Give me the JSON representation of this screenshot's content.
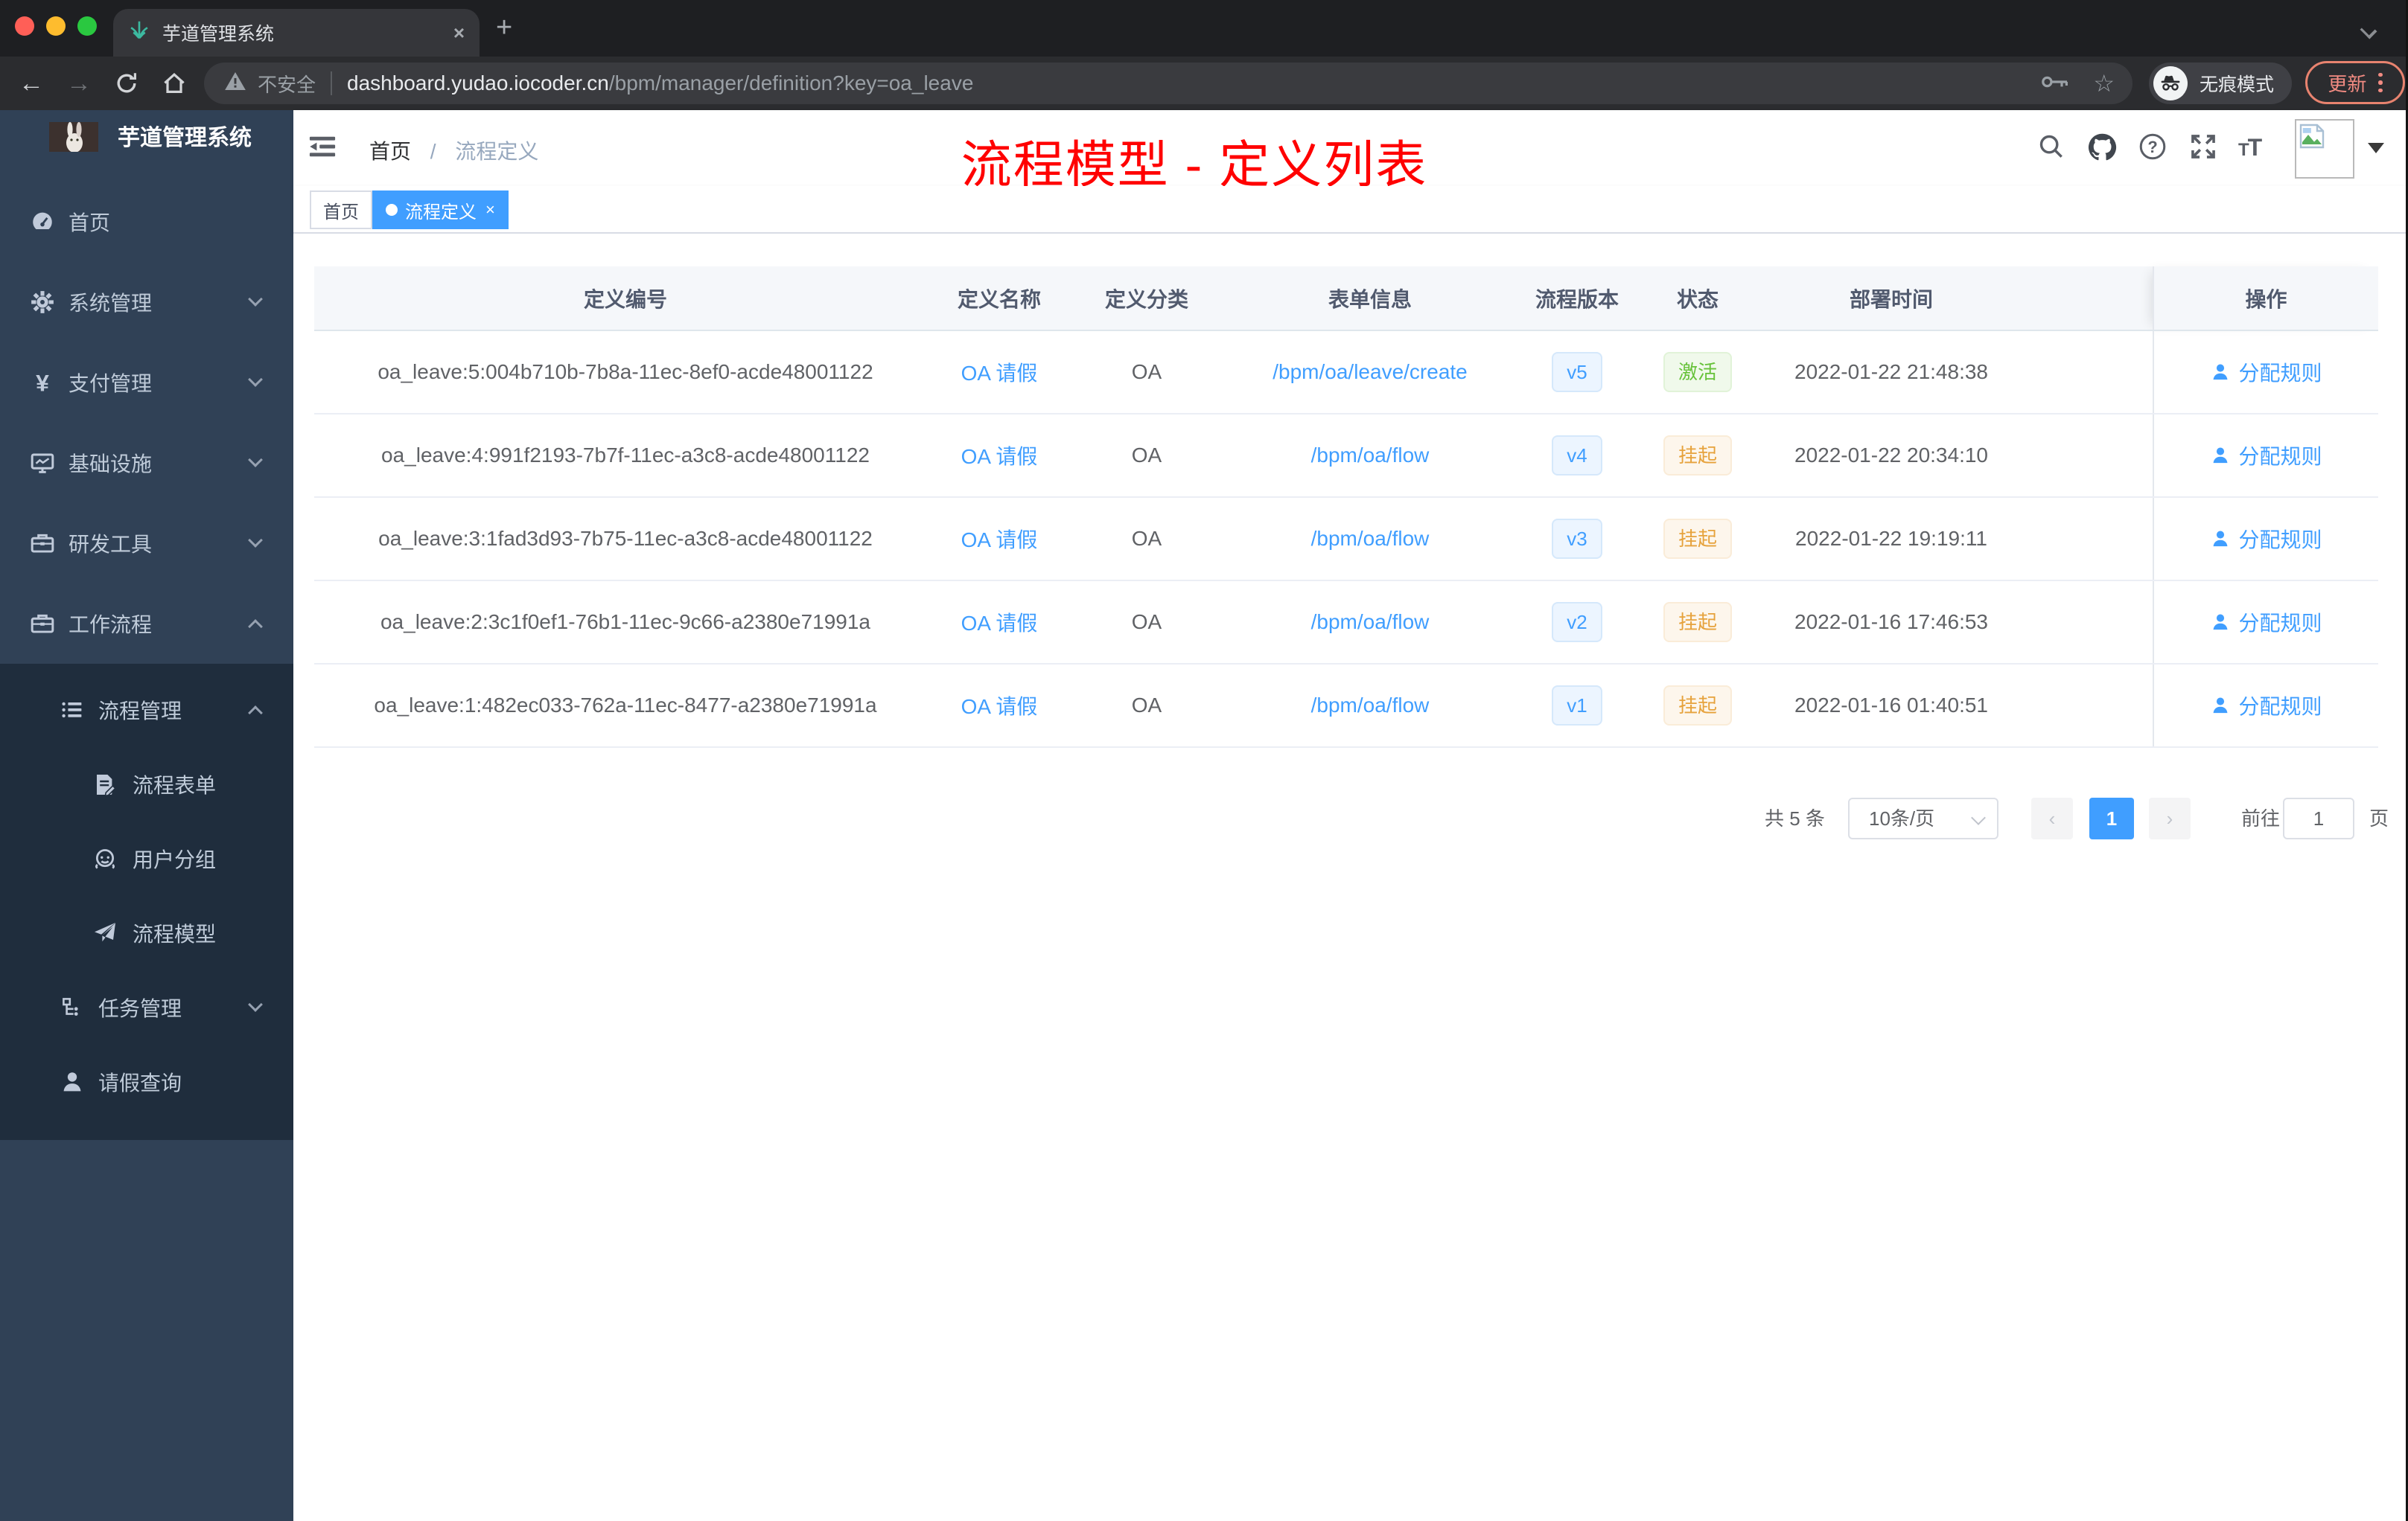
{
  "browser": {
    "tab_title": "芋道管理系统",
    "new_tab": "+",
    "close_tab": "×",
    "security_label": "不安全",
    "url_domain": "dashboard.yudao.iocoder.cn",
    "url_path": "/bpm/manager/definition?key=oa_leave",
    "incognito_label": "无痕模式",
    "update_label": "更新",
    "back": "←",
    "forward": "→"
  },
  "sidebar": {
    "title": "芋道管理系统",
    "menu_top": [
      {
        "label": "首页",
        "icon": "dashboard-icon",
        "chevron": ""
      },
      {
        "label": "系统管理",
        "icon": "gear-icon",
        "chevron": "down"
      },
      {
        "label": "支付管理",
        "icon": "yen-icon",
        "chevron": "down"
      },
      {
        "label": "基础设施",
        "icon": "monitor-icon",
        "chevron": "down"
      },
      {
        "label": "研发工具",
        "icon": "toolbox-icon",
        "chevron": "down"
      },
      {
        "label": "工作流程",
        "icon": "briefcase-icon",
        "chevron": "up"
      }
    ],
    "menu_sub": [
      {
        "label": "流程管理",
        "icon": "list-icon",
        "level": 1,
        "chevron": "up"
      },
      {
        "label": "流程表单",
        "icon": "form-icon",
        "level": 2,
        "chevron": ""
      },
      {
        "label": "用户分组",
        "icon": "users-icon",
        "level": 2,
        "chevron": ""
      },
      {
        "label": "流程模型",
        "icon": "plane-icon",
        "level": 2,
        "chevron": ""
      },
      {
        "label": "任务管理",
        "icon": "tasks-icon",
        "level": 1,
        "chevron": "down"
      },
      {
        "label": "请假查询",
        "icon": "person-icon",
        "level": 1,
        "chevron": ""
      }
    ]
  },
  "header": {
    "breadcrumb_home": "首页",
    "breadcrumb_sep": "/",
    "breadcrumb_current": "流程定义",
    "annotation": "流程模型 - 定义列表",
    "font_icon": "TT"
  },
  "tags": {
    "home": "首页",
    "active": "流程定义",
    "close": "×"
  },
  "table": {
    "columns": [
      "定义编号",
      "定义名称",
      "定义分类",
      "表单信息",
      "流程版本",
      "状态",
      "部署时间",
      "操作"
    ],
    "rows": [
      {
        "id": "oa_leave:5:004b710b-7b8a-11ec-8ef0-acde48001122",
        "name": "OA 请假",
        "category": "OA",
        "form": "/bpm/oa/leave/create",
        "version": "v5",
        "status": "激活",
        "status_type": "active",
        "time": "2022-01-22 21:48:38",
        "action": "分配规则"
      },
      {
        "id": "oa_leave:4:991f2193-7b7f-11ec-a3c8-acde48001122",
        "name": "OA 请假",
        "category": "OA",
        "form": "/bpm/oa/flow",
        "version": "v4",
        "status": "挂起",
        "status_type": "suspend",
        "time": "2022-01-22 20:34:10",
        "action": "分配规则"
      },
      {
        "id": "oa_leave:3:1fad3d93-7b75-11ec-a3c8-acde48001122",
        "name": "OA 请假",
        "category": "OA",
        "form": "/bpm/oa/flow",
        "version": "v3",
        "status": "挂起",
        "status_type": "suspend",
        "time": "2022-01-22 19:19:11",
        "action": "分配规则"
      },
      {
        "id": "oa_leave:2:3c1f0ef1-76b1-11ec-9c66-a2380e71991a",
        "name": "OA 请假",
        "category": "OA",
        "form": "/bpm/oa/flow",
        "version": "v2",
        "status": "挂起",
        "status_type": "suspend",
        "time": "2022-01-16 17:46:53",
        "action": "分配规则"
      },
      {
        "id": "oa_leave:1:482ec033-762a-11ec-8477-a2380e71991a",
        "name": "OA 请假",
        "category": "OA",
        "form": "/bpm/oa/flow",
        "version": "v1",
        "status": "挂起",
        "status_type": "suspend",
        "time": "2022-01-16 01:40:51",
        "action": "分配规则"
      }
    ]
  },
  "pagination": {
    "total": "共 5 条",
    "page_size": "10条/页",
    "prev": "‹",
    "current": "1",
    "next": "›",
    "goto_label": "前往",
    "goto_value": "1",
    "page_label": "页"
  },
  "colors": {
    "accent_blue": "#409eff",
    "success_green": "#67c23a",
    "warning_orange": "#e6a23c",
    "annotation_red": "#ff0000",
    "sidebar_bg": "#304156",
    "submenu_bg": "#1f2d3d"
  }
}
